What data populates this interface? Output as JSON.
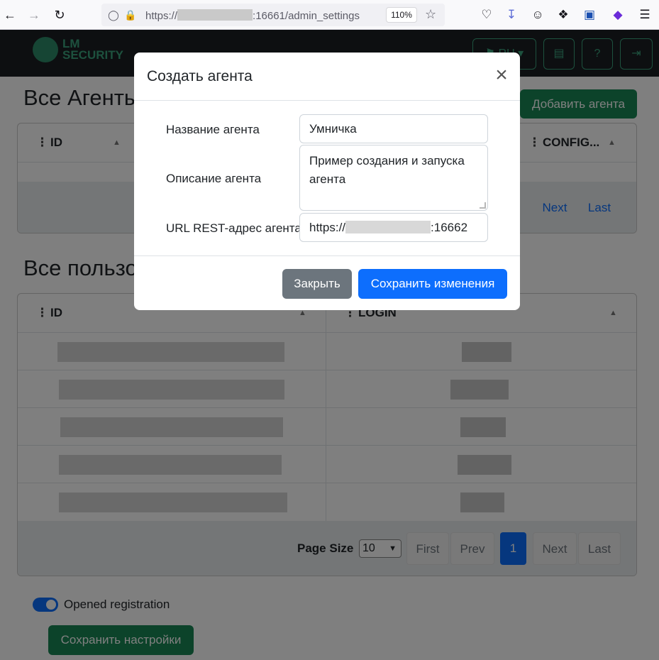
{
  "browser": {
    "url_prefix": "https://",
    "url_suffix": ":16661/admin_settings",
    "zoom": "110%"
  },
  "navbar": {
    "logo_line1": "LM",
    "logo_line2": "SECURITY",
    "lang_label": "RU"
  },
  "agents_section": {
    "title": "Все Агенты",
    "add_button": "Добавить агента",
    "col_id": "ID",
    "col_config": "CONFIG...",
    "next": "Next",
    "last": "Last"
  },
  "users_section": {
    "title": "Все пользователи",
    "col_id": "ID",
    "col_login": "LOGIN",
    "page_size_label": "Page Size",
    "page_size_value": "10",
    "page_size_options": [
      "10"
    ],
    "first": "First",
    "prev": "Prev",
    "current_page": "1",
    "next": "Next",
    "last": "Last"
  },
  "registration": {
    "label": "Opened registration",
    "save_button": "Сохранить настройки"
  },
  "modal": {
    "title": "Создать агента",
    "name_label": "Название агента",
    "name_value": "Умничка",
    "desc_label": "Описание агента",
    "desc_value": "Пример создания и запуска агента",
    "url_label": "URL REST-адрес агента",
    "url_prefix": "https://",
    "url_suffix": ":16662",
    "close_button": "Закрыть",
    "save_button": "Сохранить изменения"
  }
}
